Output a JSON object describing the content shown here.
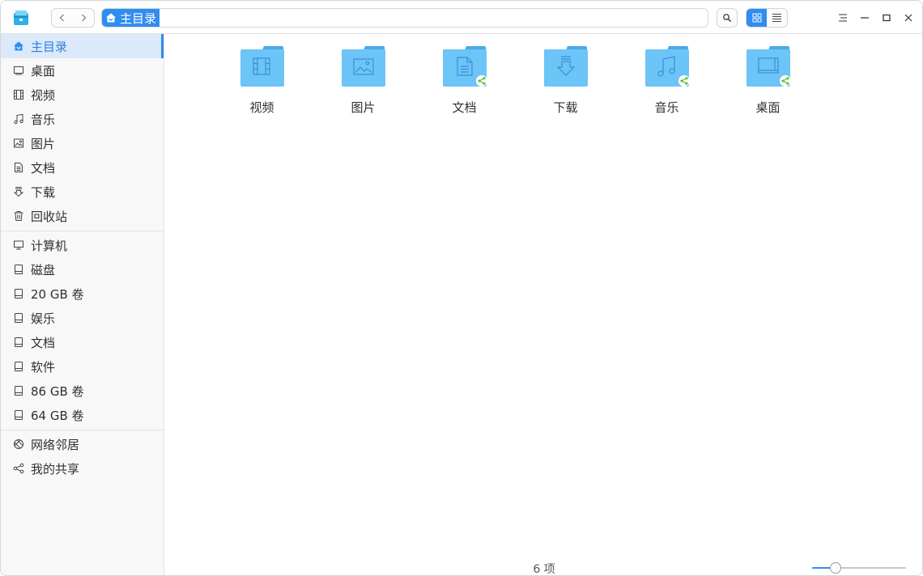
{
  "breadcrumb": {
    "label": "主目录"
  },
  "sidebar": {
    "places": [
      {
        "label": "主目录",
        "icon": "home-icon",
        "active": true
      },
      {
        "label": "桌面",
        "icon": "desktop-icon"
      },
      {
        "label": "视频",
        "icon": "video-icon"
      },
      {
        "label": "音乐",
        "icon": "music-icon"
      },
      {
        "label": "图片",
        "icon": "picture-icon"
      },
      {
        "label": "文档",
        "icon": "document-icon"
      },
      {
        "label": "下载",
        "icon": "download-icon"
      },
      {
        "label": "回收站",
        "icon": "trash-icon"
      }
    ],
    "devices": [
      {
        "label": "计算机",
        "icon": "computer-icon"
      },
      {
        "label": "磁盘",
        "icon": "disk-icon"
      },
      {
        "label": "20 GB 卷",
        "icon": "disk-icon"
      },
      {
        "label": "娱乐",
        "icon": "disk-icon"
      },
      {
        "label": "文档",
        "icon": "disk-icon"
      },
      {
        "label": "软件",
        "icon": "disk-icon"
      },
      {
        "label": "86 GB 卷",
        "icon": "disk-icon"
      },
      {
        "label": "64 GB 卷",
        "icon": "disk-icon"
      }
    ],
    "network": [
      {
        "label": "网络邻居",
        "icon": "network-icon"
      },
      {
        "label": "我的共享",
        "icon": "share-icon"
      }
    ]
  },
  "files": [
    {
      "label": "视频",
      "icon": "video-folder-icon",
      "shared": false
    },
    {
      "label": "图片",
      "icon": "picture-folder-icon",
      "shared": false
    },
    {
      "label": "文档",
      "icon": "document-folder-icon",
      "shared": true
    },
    {
      "label": "下载",
      "icon": "download-folder-icon",
      "shared": false
    },
    {
      "label": "音乐",
      "icon": "music-folder-icon",
      "shared": true
    },
    {
      "label": "桌面",
      "icon": "desktop-folder-icon",
      "shared": true
    }
  ],
  "status": {
    "item_count": "6 项"
  },
  "zoom": {
    "level": 0.22
  },
  "view": {
    "mode": "icon"
  },
  "colors": {
    "accent": "#2f8cf0",
    "folder": "#6cc4f7",
    "folder_tab": "#4aa9e6",
    "share_badge": "#5cc033"
  }
}
